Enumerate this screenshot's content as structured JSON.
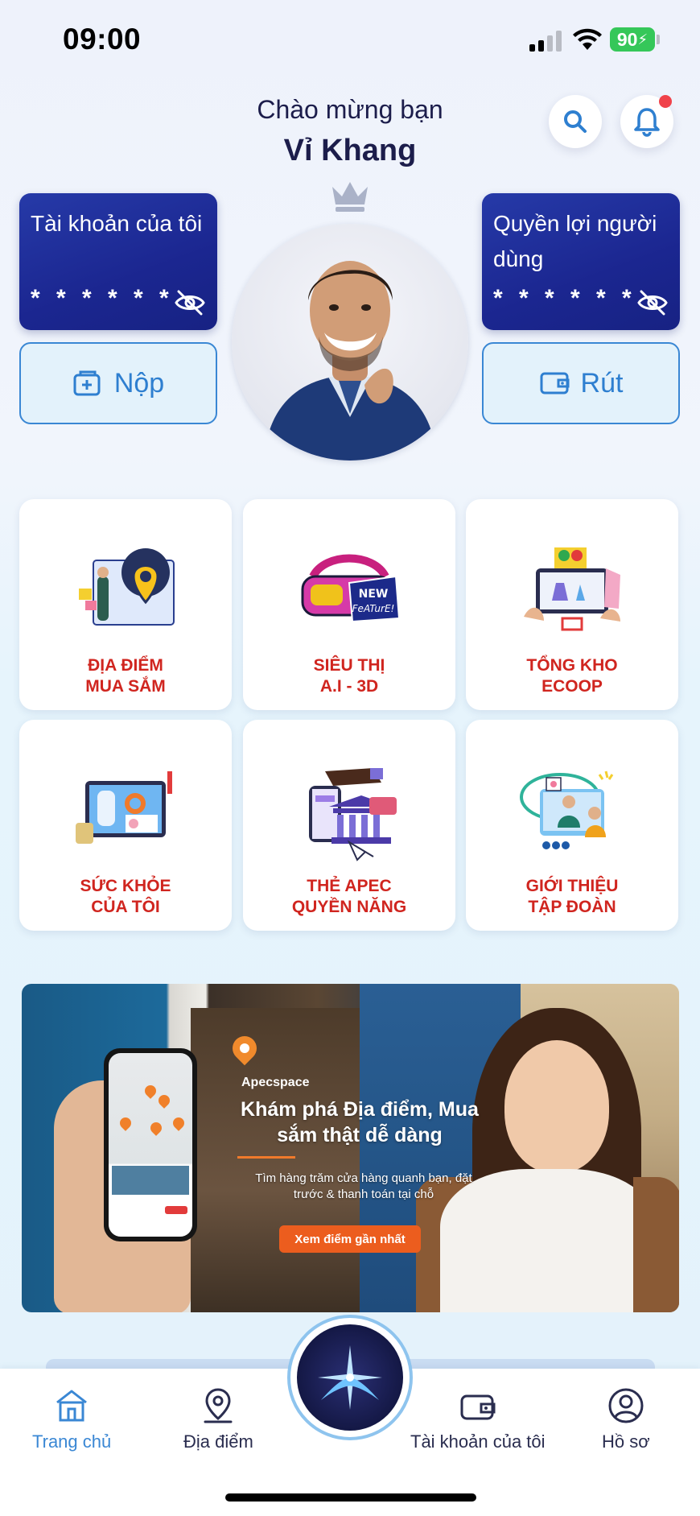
{
  "status": {
    "time": "09:00",
    "battery": "90"
  },
  "header": {
    "greeting": "Chào mừng bạn",
    "name": "Vỉ Khang"
  },
  "accounts": {
    "left": {
      "title": "Tài khoản của tôi",
      "masked": "* * * * * *",
      "action": "Nộp"
    },
    "right": {
      "title": "Quyền lợi người dùng",
      "masked": "* * * * * *",
      "action": "Rút"
    }
  },
  "features": [
    {
      "line1": "ĐỊA ĐIỂM",
      "line2": "MUA SẮM"
    },
    {
      "line1": "SIÊU THỊ",
      "line2": "A.I - 3D"
    },
    {
      "line1": "TỔNG KHO",
      "line2": "ECOOP"
    },
    {
      "line1": "SỨC KHỎE",
      "line2": "CỦA TÔI"
    },
    {
      "line1": "THẺ APEC",
      "line2": "QUYỀN NĂNG"
    },
    {
      "line1": "GIỚI THIỆU",
      "line2": "TẬP ĐOÀN"
    }
  ],
  "banner": {
    "brand": "Apecspace",
    "title": "Khám phá Địa điểm, Mua sắm thật dễ dàng",
    "description": "Tìm hàng trăm cửa hàng quanh bạn, đặt trước & thanh toán tại chỗ",
    "cta": "Xem điểm gần nhất",
    "accent": "#ec5d1e"
  },
  "tabs": [
    {
      "label": "Trang chủ",
      "icon": "home-icon",
      "active": true
    },
    {
      "label": "Địa điểm",
      "icon": "location-icon",
      "active": false
    },
    {
      "label": "Tài khoản của tôi",
      "icon": "wallet-icon",
      "active": false
    },
    {
      "label": "Hồ sơ",
      "icon": "profile-icon",
      "active": false
    }
  ],
  "colors": {
    "accent": "#3a87d4",
    "card": "#1b2690",
    "feature_label": "#d0251f"
  }
}
